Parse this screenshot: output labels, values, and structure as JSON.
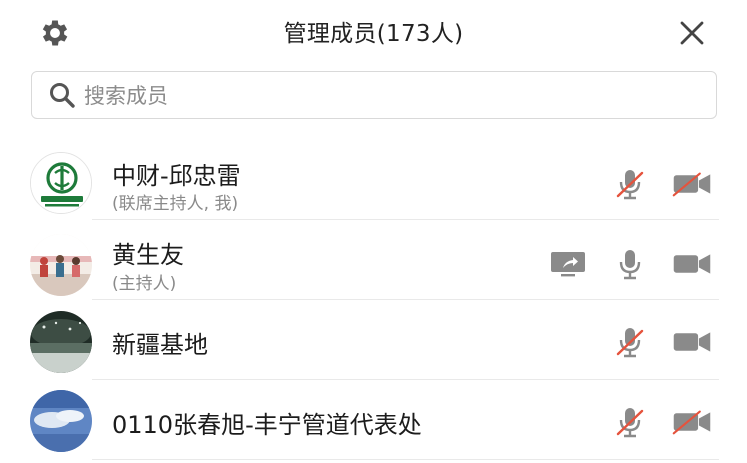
{
  "header": {
    "title": "管理成员(173人)",
    "settings_icon": "gear-icon",
    "close_icon": "close-icon"
  },
  "search": {
    "placeholder": "搜索成员",
    "icon": "search-icon"
  },
  "members": [
    {
      "name": "中财-邱忠雷",
      "role": "(联席主持人, 我)",
      "avatar": "zhongcai-logo",
      "mic": "muted",
      "camera": "off",
      "sharing": false
    },
    {
      "name": "黄生友",
      "role": "(主持人)",
      "avatar": "photo-people",
      "mic": "on",
      "camera": "on",
      "sharing": true
    },
    {
      "name": "新疆基地",
      "role": "",
      "avatar": "photo-landscape",
      "mic": "muted",
      "camera": "on",
      "sharing": false
    },
    {
      "name": "0110张春旭-丰宁管道代表处",
      "role": "",
      "avatar": "photo-sky",
      "mic": "muted",
      "camera": "off",
      "sharing": false
    }
  ],
  "colors": {
    "icon_gray": "#7a7a7a",
    "muted_slash": "#e5533d",
    "logo_green": "#1e7b3a",
    "divider": "#e9e9e9"
  }
}
